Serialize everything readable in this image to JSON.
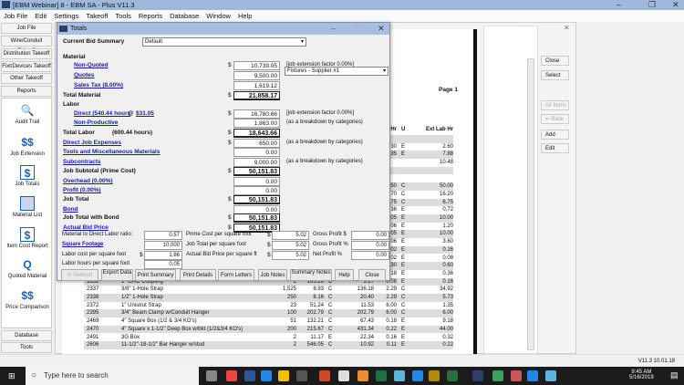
{
  "app": {
    "title": "[EBM Webinar] 8 - EBM SA  - Plus V11.3",
    "version": "V11.3 10.01.18"
  },
  "menu": [
    "Job File",
    "Edit",
    "Settings",
    "Takeoff",
    "Tools",
    "Reports",
    "Database",
    "Window",
    "Help"
  ],
  "sidebar": {
    "buttons": [
      "Job File",
      "Wire/Conduit Takeoff",
      "Distribution Takeoff",
      "Fixt/Devices Takeoff",
      "Other Takeoff",
      "Reports"
    ],
    "items": [
      {
        "label": "Audit Trail",
        "icon": "audit-trail-icon"
      },
      {
        "label": "Job Extension",
        "icon": "dollar-icon"
      },
      {
        "label": "Job Totals",
        "icon": "job-totals-icon"
      },
      {
        "label": "Material List",
        "icon": "material-list-icon"
      },
      {
        "label": "Item Cost Report",
        "icon": "item-cost-icon"
      },
      {
        "label": "Quoted Material",
        "icon": "quoted-icon"
      },
      {
        "label": "Price Comparison",
        "icon": "dollar-icon"
      }
    ],
    "bottom": [
      "Database",
      "Tools"
    ]
  },
  "report": {
    "page": "Page 1",
    "headers": [
      "Labor Hr",
      "U",
      "Ext Lab Hr"
    ],
    "rows": [
      [
        "",
        "",
        "",
        "",
        "",
        "",
        "",
        "",
        ""
      ],
      [
        "",
        "",
        "",
        "",
        "",
        "",
        "1.30",
        "E",
        "2.60"
      ],
      [
        "",
        "",
        "",
        "",
        "",
        "",
        "0.35",
        "E",
        "7.88"
      ],
      [
        "",
        "",
        "",
        "",
        "",
        "",
        "",
        "",
        "10.48"
      ],
      [
        "",
        "",
        "",
        "",
        "",
        "",
        "",
        "",
        ""
      ],
      [
        "",
        "",
        "",
        "",
        "",
        "",
        "",
        "",
        ""
      ],
      [
        "",
        "",
        "",
        "",
        "",
        "",
        "2.50",
        "C",
        "50.00"
      ],
      [
        "",
        "",
        "",
        "",
        "",
        "",
        "2.70",
        "C",
        "16.20"
      ],
      [
        "",
        "",
        "",
        "",
        "",
        "",
        "3.75",
        "C",
        "6.75"
      ],
      [
        "",
        "",
        "",
        "",
        "",
        "",
        "0.36",
        "E",
        "0.72"
      ],
      [
        "",
        "",
        "",
        "",
        "",
        "",
        "0.05",
        "E",
        "10.00"
      ],
      [
        "",
        "",
        "",
        "",
        "",
        "",
        "0.06",
        "E",
        "1.20"
      ],
      [
        "",
        "",
        "",
        "",
        "",
        "",
        "0.05",
        "E",
        "10.00"
      ],
      [
        "",
        "",
        "",
        "",
        "",
        "",
        "0.06",
        "E",
        "3.60"
      ],
      [
        "",
        "",
        "",
        "",
        "",
        "",
        "0.02",
        "E",
        "0.16"
      ],
      [
        "",
        "",
        "",
        "",
        "",
        "",
        "0.02",
        "E",
        "0.08"
      ],
      [
        "",
        "",
        "",
        "",
        "",
        "",
        "0.30",
        "E",
        "0.60"
      ],
      [
        "",
        "",
        "",
        "",
        "",
        "",
        "0.18",
        "E",
        "0.36"
      ],
      [
        "1832",
        "1\" GRC Coupling",
        "2",
        "163.26",
        "C",
        "3.27",
        "0.08",
        "E",
        "0.16"
      ],
      [
        "2337",
        "3/8\" 1-Hole Strap",
        "1,525",
        "8.93",
        "C",
        "136.18",
        "2.29",
        "C",
        "34.92"
      ],
      [
        "2338",
        "1/2\" 1-Hole Strap",
        "250",
        "8.16",
        "C",
        "20.40",
        "2.29",
        "C",
        "5.73"
      ],
      [
        "2372",
        "1\" Unistrut Strap",
        "23",
        "51.24",
        "C",
        "11.53",
        "6.00",
        "C",
        "1.35"
      ],
      [
        "2395",
        "3/4\" Beam Clamp w/Conduit Hanger",
        "100",
        "202.79",
        "C",
        "202.79",
        "6.00",
        "C",
        "6.00"
      ],
      [
        "2469",
        "4\" Square Box (1/2 & 3/4 KO's)",
        "51",
        "132.21",
        "C",
        "67.43",
        "0.18",
        "E",
        "9.18"
      ],
      [
        "2470",
        "4\" Square x 1-1/2\" Deep Box w/bkt (1/2&3/4 KO's)",
        "200",
        "215.67",
        "C",
        "431.34",
        "0.22",
        "E",
        "44.00"
      ],
      [
        "2491",
        "3G Box",
        "2",
        "11.17",
        "E",
        "22.34",
        "0.16",
        "E",
        "0.32"
      ],
      [
        "2606",
        "11-1/2\"-18-1/2\" Bar Hanger w/stud",
        "2",
        "546.05",
        "C",
        "10.92",
        "0.11",
        "E",
        "0.22"
      ]
    ]
  },
  "side_buttons": {
    "close": "Close",
    "select": "Select",
    "all_items": "All Items",
    "back": "Back",
    "add": "Add",
    "edit": "Edit"
  },
  "totals": {
    "title": "Totals",
    "current_bid_summary_label": "Current Bid Summary",
    "current_bid_summary": "Default",
    "material_label": "Material",
    "non_quoted": {
      "label": "Non-Quoted",
      "value": "10,739.05",
      "note": "[job extension factor 0.00%]"
    },
    "quotes": {
      "label": "Quotes",
      "value": "9,500.00",
      "supplier": "Fixtures - Supplier #1"
    },
    "sales_tax": {
      "label": "Sales Tax (8.00%)",
      "value": "1,619.12"
    },
    "total_material": {
      "label": "Total Material",
      "value": "21,858.17"
    },
    "labor_label": "Labor",
    "direct": {
      "label": "Direct (540.44 hours",
      "at": "@",
      "rate": "$31.05",
      "value": "16,780.66",
      "note": "[job extension factor 0.00%]"
    },
    "non_productive": {
      "label": "Non-Productive",
      "value": "1,863.00",
      "note": "(as a breakdown by categories)"
    },
    "total_labor": {
      "label": "Total Labor",
      "hours": "(600.44 hours)",
      "value": "18,643.66"
    },
    "direct_job_expenses": {
      "label": "Direct Job Expenses",
      "value": "650.00",
      "note": "(as a breakdown by categories)"
    },
    "tools_misc": {
      "label": "Tools and Miscellaneous Materials",
      "value": "0.00"
    },
    "subcontracts": {
      "label": "Subcontracts",
      "value": "9,000.00",
      "note": "(as a breakdown by categories)"
    },
    "job_subtotal": {
      "label": "Job Subtotal (Prime Cost)",
      "value": "50,151.83"
    },
    "overhead": {
      "label": "Overhead (0.00%)",
      "value": "0.00"
    },
    "profit": {
      "label": "Profit (0.00%)",
      "value": "0.00"
    },
    "job_total": {
      "label": "Job Total",
      "value": "50,151.83"
    },
    "bond": {
      "label": "Bond",
      "value": "0.00"
    },
    "job_total_bond": {
      "label": "Job Total with Bond",
      "value": "50,151.83"
    },
    "actual_bid": {
      "label": "Actual Bid Price",
      "value": "50,151.83"
    },
    "currency": "$",
    "stats": {
      "ratio": {
        "label": "Material to Direct Labor ratio:",
        "value": "0.57"
      },
      "sqft": {
        "label": "Square Footage",
        "value": "10,000"
      },
      "labor_cost_sqft": {
        "label": "Labor cost per square foot",
        "value": "1.86"
      },
      "labor_hours_sqft": {
        "label": "Labor hours per square foot",
        "value": "0.05"
      },
      "prime_sqft": {
        "label": "Prime Cost per square foot",
        "value": "5.02"
      },
      "job_total_sqft": {
        "label": "Job Total per square foot",
        "value": "5.02"
      },
      "bid_sqft": {
        "label": "Actual Bid Price per square ft",
        "value": "5.02"
      },
      "gross_profit": {
        "label": "Gross Profit $",
        "value": "0.00"
      },
      "gross_profit_pct": {
        "label": "Gross Profit %",
        "value": "0.00"
      },
      "net_profit_pct": {
        "label": "Net Profit %",
        "value": "0.00"
      }
    },
    "buttons": {
      "refresh": "Refresh",
      "export": "Export Data",
      "print_summary": "Print Summary",
      "print_details": "Print Details",
      "form_letters": "Form Letters",
      "job_notes": "Job Notes",
      "summary_notes": "Summary Notes",
      "help": "Help",
      "close": "Close"
    }
  },
  "taskbar": {
    "search_placeholder": "Type here to search",
    "time": "9:45 AM",
    "date": "5/16/2019"
  }
}
